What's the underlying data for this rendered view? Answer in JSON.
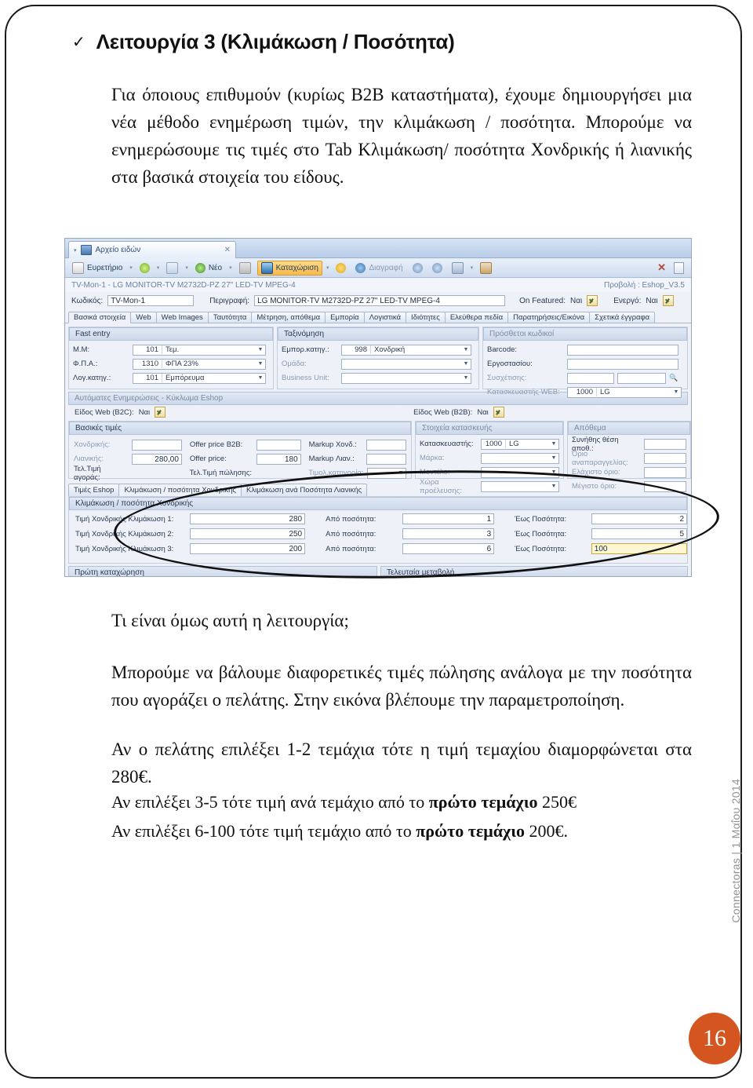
{
  "slide": {
    "heading": "Λειτουργία 3 (Κλιμάκωση / Ποσότητα)",
    "tick_icon": "✓",
    "intro": "Για όποιους επιθυμούν (κυρίως   B2B καταστήματα), έχουμε δημιουργήσει μια νέα μέθοδο ενημέρωση τιμών, την κλιμάκωση / ποσότητα. Μπορούμε να ενημερώσουμε τις τιμές στο Tab Κλιμάκωση/ ποσότητα Χονδρικής ή  λιανικής στα βασικά στοιχεία του είδους.",
    "question": "Τι είναι όμως αυτή η λειτουργία;",
    "para2": "Μπορούμε να βάλουμε διαφορετικές τιμές πώλησης ανάλογα με την ποσότητα που αγοράζει ο πελάτης. Στην εικόνα βλέπουμε την παραμετροποίηση.",
    "para3": "Αν ο πελάτης επιλέξει 1-2 τεμάχια τότε η τιμή τεμαχίου διαμορφώνεται στα 280€.",
    "para4_pre": "Αν επιλέξει 3-5 τότε τιμή ανά τεμάχιο από το ",
    "para4_bold": "πρώτο τεμάχιο",
    "para4_post": " 250€",
    "para5_pre": "Αν επιλέξει 6-100 τότε τιμή τεμάχιο από το ",
    "para5_bold": "πρώτο τεμάχιο",
    "para5_post": " 200€."
  },
  "footer": {
    "credit": "Connectoras | 1 Μαΐου 2014",
    "page_number": "16",
    "badge_color": "#d4551f"
  },
  "app": {
    "window_tab": "Αρχείο ειδών",
    "close_glyph": "✕",
    "toolbar": [
      {
        "label": "Ευρετήριο",
        "icon": "index-icon",
        "state": "normal"
      },
      {
        "label": "",
        "icon": "star-icon",
        "state": "normal"
      },
      {
        "label": "",
        "icon": "search-icon",
        "state": "normal"
      },
      {
        "label": "Νέο",
        "icon": "new-icon",
        "state": "normal"
      },
      {
        "label": "",
        "icon": "copy-icon",
        "state": "normal"
      },
      {
        "label": "Καταχώριση",
        "icon": "save-icon",
        "state": "highlighted"
      },
      {
        "label": "",
        "icon": "smiley-icon",
        "state": "normal"
      },
      {
        "label": "Διαγραφή",
        "icon": "delete-icon",
        "state": "dim"
      },
      {
        "label": "",
        "icon": "prev-icon",
        "state": "normal"
      },
      {
        "label": "",
        "icon": "next-icon",
        "state": "normal"
      },
      {
        "label": "",
        "icon": "print-icon",
        "state": "normal"
      },
      {
        "label": "",
        "icon": "export-icon",
        "state": "normal"
      }
    ],
    "record_header": "TV-Mon-1 - LG MONITOR-TV M2732D-PZ 27\" LED-TV MPEG-4",
    "view_label": "Προβολή : Eshop_V3.5",
    "code_label": "Κωδικός:",
    "code_value": "TV-Mon-1",
    "desc_label": "Περιγραφή:",
    "desc_value": "LG MONITOR-TV M2732D-PZ 27\" LED-TV MPEG-4",
    "on_featured_label": "On Featured:",
    "on_featured_value": "Ναι",
    "active_label": "Ενεργό:",
    "active_value": "Ναι",
    "main_tabs": [
      "Βασικά στοιχεία",
      "Web",
      "Web Images",
      "Ταυτότητα",
      "Μέτρηση, απόθεμα",
      "Εμπορία",
      "Λογιστικά",
      "Ιδιότητες",
      "Ελεύθερα πεδία",
      "Παρατηρήσεις/Εικόνα",
      "Σχετικά έγγραφα"
    ],
    "main_tab_active": "Βασικά στοιχεία",
    "fast_entry": {
      "title": "Fast entry",
      "rows": [
        {
          "label": "Μ.Μ:",
          "code": "101",
          "text": "Τεμ."
        },
        {
          "label": "Φ.Π.Α.:",
          "code": "1310",
          "text": "ΦΠΑ 23%"
        },
        {
          "label": "Λογ.κατηγ.:",
          "code": "101",
          "text": "Εμπόρευμα"
        }
      ]
    },
    "classification": {
      "title": "Ταξινόμηση",
      "rows": [
        {
          "label": "Εμπορ.κατηγ.:",
          "code": "998",
          "text": "Χονδρική"
        },
        {
          "label": "Ομάδα:",
          "code": "",
          "text": ""
        },
        {
          "label": "Business Unit:",
          "code": "",
          "text": ""
        }
      ]
    },
    "extra_codes": {
      "title": "Πρόσθετοι κωδικοί",
      "rows": [
        {
          "label": "Barcode:",
          "code": "",
          "text": ""
        },
        {
          "label": "Εργοστασίου:",
          "code": "",
          "text": ""
        },
        {
          "label": "Συσχέτισης:",
          "code": "",
          "text": ""
        },
        {
          "label": "Κατασκευαστής WEB:",
          "code": "1000",
          "text": "LG"
        }
      ]
    },
    "auto_updates": {
      "title": "Αυτόματες Ενημερώσεις - Κύκλωμα Eshop",
      "b2c_label": "Είδος Web (B2C):",
      "b2c_value": "Ναι",
      "b2b_label": "Είδος Web (B2B):",
      "b2b_value": "Ναι"
    },
    "base_prices": {
      "title": "Βασικές τιμές",
      "rows": [
        {
          "l1": "Χονδρικής:",
          "v1": "",
          "l2": "Offer price B2B:",
          "v2": "",
          "l3": "Markup Χονδ.:",
          "v3": ""
        },
        {
          "l1": "Λιανικής:",
          "v1": "280,00",
          "l2": "Offer price:",
          "v2": "180",
          "l3": "Markup Λιαν.:",
          "v3": ""
        },
        {
          "l1": "Τελ.Τιμή αγοράς:",
          "v1": "",
          "l2": "Τελ.Τιμή πώλησης:",
          "v2": "",
          "l3": "Τιμολ.κατηγορία:",
          "v3": ""
        }
      ]
    },
    "manufacture": {
      "title": "Στοιχεία κατασκευής",
      "rows": [
        {
          "label": "Κατασκευαστής:",
          "code": "1000",
          "text": "LG"
        },
        {
          "label": "Μάρκα:",
          "code": "",
          "text": ""
        },
        {
          "label": "Μοντέλο:",
          "code": "",
          "text": ""
        },
        {
          "label": "Χώρα προέλευσης:",
          "code": "",
          "text": ""
        }
      ]
    },
    "stock": {
      "title": "Απόθεμα",
      "rows": [
        {
          "label": "Συνήθης θέση αποθ.:",
          "value": ""
        },
        {
          "label": "Όριο αναπαραγγελίας:",
          "value": ""
        },
        {
          "label": "Ελάχιστο όριο:",
          "value": ""
        },
        {
          "label": "Μέγιστο όριο:",
          "value": ""
        }
      ]
    },
    "sub_tabs": [
      "Τιμές Eshop",
      "Κλιμάκωση / ποσότητα Χονδρικής",
      "Κλιμάκωση ανά Ποσότητα Λιανικής"
    ],
    "sub_tab_active": "Κλιμάκωση / ποσότητα Χονδρικής",
    "scale_panel_title": "Κλιμάκωση / ποσότητα Χονδρικής",
    "scale_rows": [
      {
        "label": "Τιμή Χονδρικής Κλιμάκωση 1:",
        "price": "280",
        "from_label": "Από ποσότητα:",
        "from": "1",
        "to_label": "Έως Ποσότητα:",
        "to": "2",
        "focused": false
      },
      {
        "label": "Τιμή Χονδρικής Κλιμάκωση 2:",
        "price": "250",
        "from_label": "Από ποσότητα:",
        "from": "3",
        "to_label": "Έως Ποσότητα:",
        "to": "5",
        "focused": false
      },
      {
        "label": "Τιμή Χονδρικής Κλιμάκωση 3:",
        "price": "200",
        "from_label": "Από ποσότητα:",
        "from": "6",
        "to_label": "Έως Ποσότητα:",
        "to": "100",
        "focused": true
      }
    ],
    "first_entry_title": "Πρώτη καταχώρηση",
    "last_change_title": "Τελευταία μεταβολή"
  }
}
